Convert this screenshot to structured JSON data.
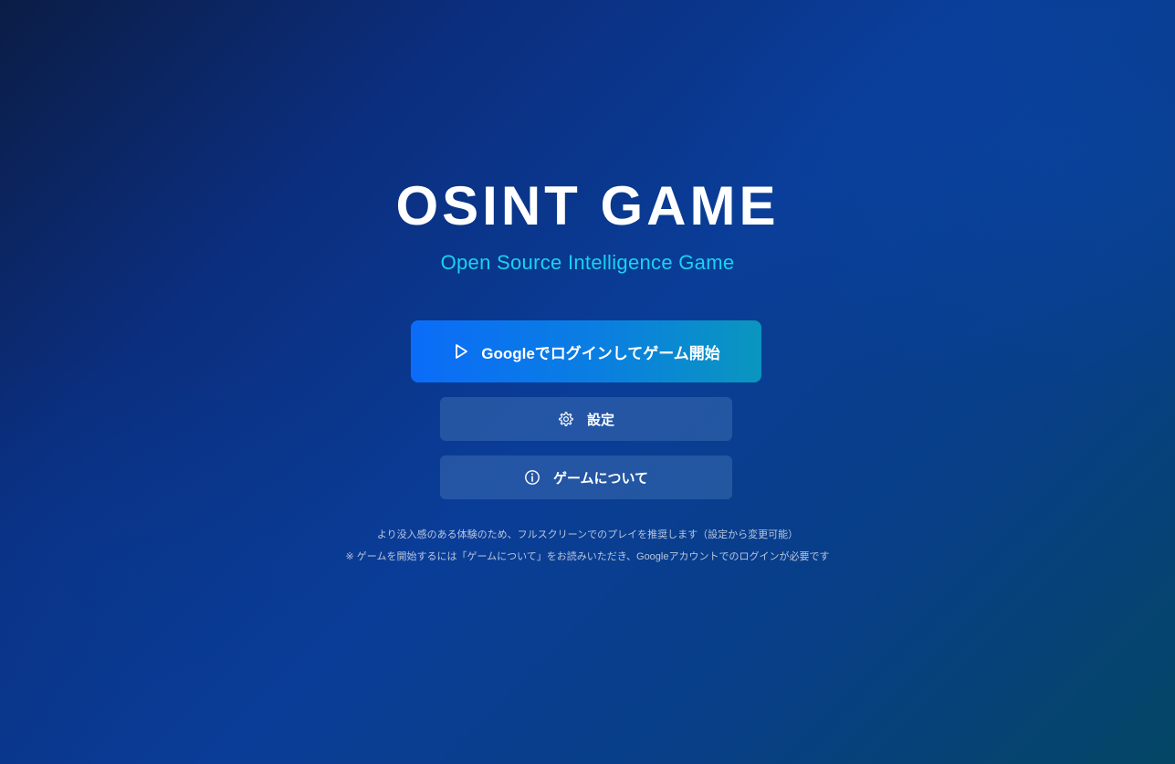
{
  "header": {
    "title": "OSINT GAME",
    "subtitle": "Open Source Intelligence Game"
  },
  "actions": {
    "login_label": "Googleでログインしてゲーム開始",
    "settings_label": "設定",
    "about_label": "ゲームについて"
  },
  "icons": {
    "login": "play-icon",
    "settings": "gear-icon",
    "about": "info-icon"
  },
  "notes": {
    "fullscreen": "より没入感のある体験のため、フルスクリーンでのプレイを推奨します（設定から変更可能）",
    "requirement": "※ ゲームを開始するには「ゲームについて」をお読みいただき、Googleアカウントでのログインが必要です"
  },
  "colors": {
    "accent": "#19d3f0",
    "primary_button_start": "#0b6cf8",
    "primary_button_end": "#0a96bf"
  }
}
